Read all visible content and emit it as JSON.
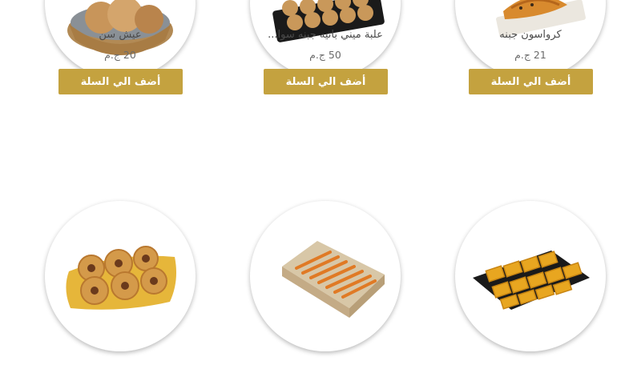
{
  "products": [
    {
      "name": "عيش سن",
      "price": "20 ج.م",
      "button": "أضف الي السلة",
      "image": "bread-basket"
    },
    {
      "name": "علبة ميني باتيه جبنه سوا...",
      "price": "50 ج.م",
      "button": "أضف الي السلة",
      "image": "mini-pate-tray"
    },
    {
      "name": "كرواسون جبنه",
      "price": "21 ج.م",
      "button": "أضف الي السلة",
      "image": "cheese-croissant"
    },
    {
      "image": "vol-au-vent-plate"
    },
    {
      "image": "cheese-sticks-box"
    },
    {
      "image": "basbousa-tray"
    }
  ],
  "colors": {
    "button": "#c4a23f",
    "text": "#4a4a4a",
    "price": "#6b6b6b"
  }
}
